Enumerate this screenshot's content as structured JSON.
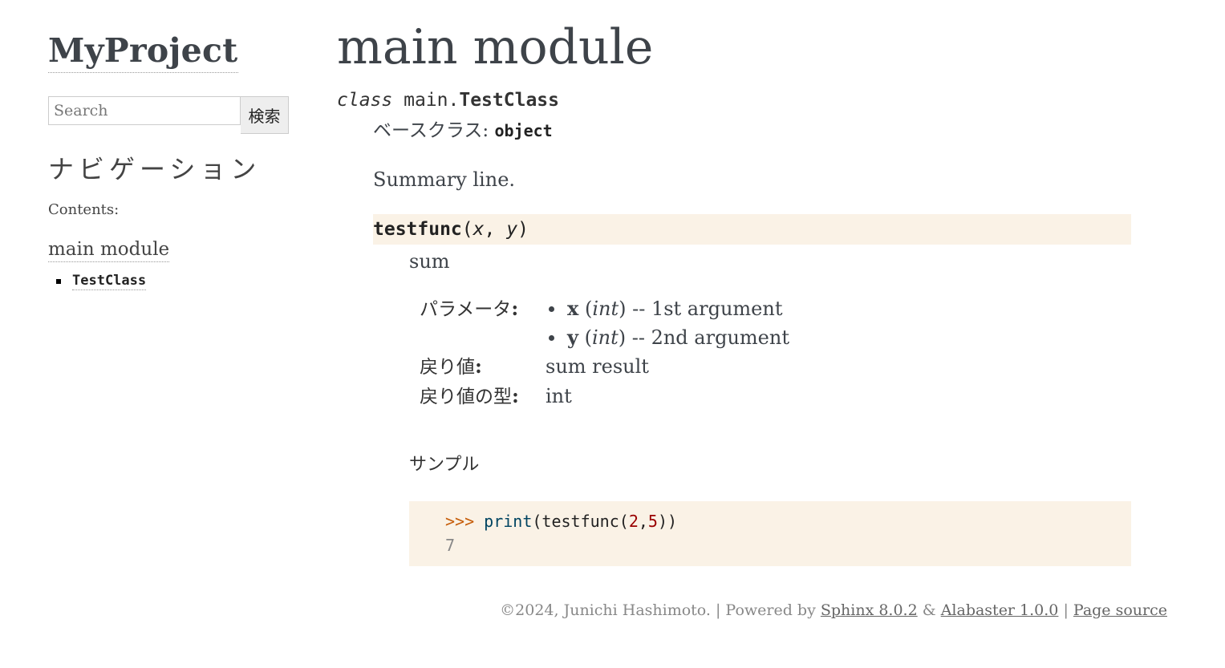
{
  "sidebar": {
    "logo": "MyProject",
    "search": {
      "placeholder": "Search",
      "button_label": "検索"
    },
    "nav_title": "ナビゲーション",
    "contents_label": "Contents:",
    "toc": {
      "main_link": "main module",
      "sub_items": [
        "TestClass"
      ]
    }
  },
  "main": {
    "title": "main module",
    "class_sig": {
      "keyword": "class",
      "module": "main.",
      "name": "TestClass"
    },
    "bases": {
      "label": "ベースクラス: ",
      "value": "object"
    },
    "summary": "Summary line.",
    "method": {
      "name": "testfunc",
      "open_paren": "(",
      "params": [
        "x",
        "y"
      ],
      "separator": ", ",
      "close_paren": ")",
      "description": "sum",
      "fields": {
        "params_label": "パラメータ",
        "params": [
          {
            "name": "x",
            "type": "int",
            "desc": "1st argument"
          },
          {
            "name": "y",
            "type": "int",
            "desc": "2nd argument"
          }
        ],
        "returns_label": "戻り値",
        "returns_value": "sum result",
        "rtype_label": "戻り値の型",
        "rtype_value": "int"
      }
    },
    "sample_heading": "サンプル",
    "code": {
      "prompt": ">>> ",
      "builtin": "print",
      "text1": "(testfunc(",
      "num1": "2",
      "comma": ",",
      "num2": "5",
      "text2": "))",
      "output": "7"
    }
  },
  "footer": {
    "copyright": "©2024, Junichi Hashimoto. | Powered by ",
    "sphinx_link": "Sphinx 8.0.2",
    "amp": " & ",
    "alabaster_link": "Alabaster 1.0.0",
    "sep": " | ",
    "source_link": "Page source"
  }
}
